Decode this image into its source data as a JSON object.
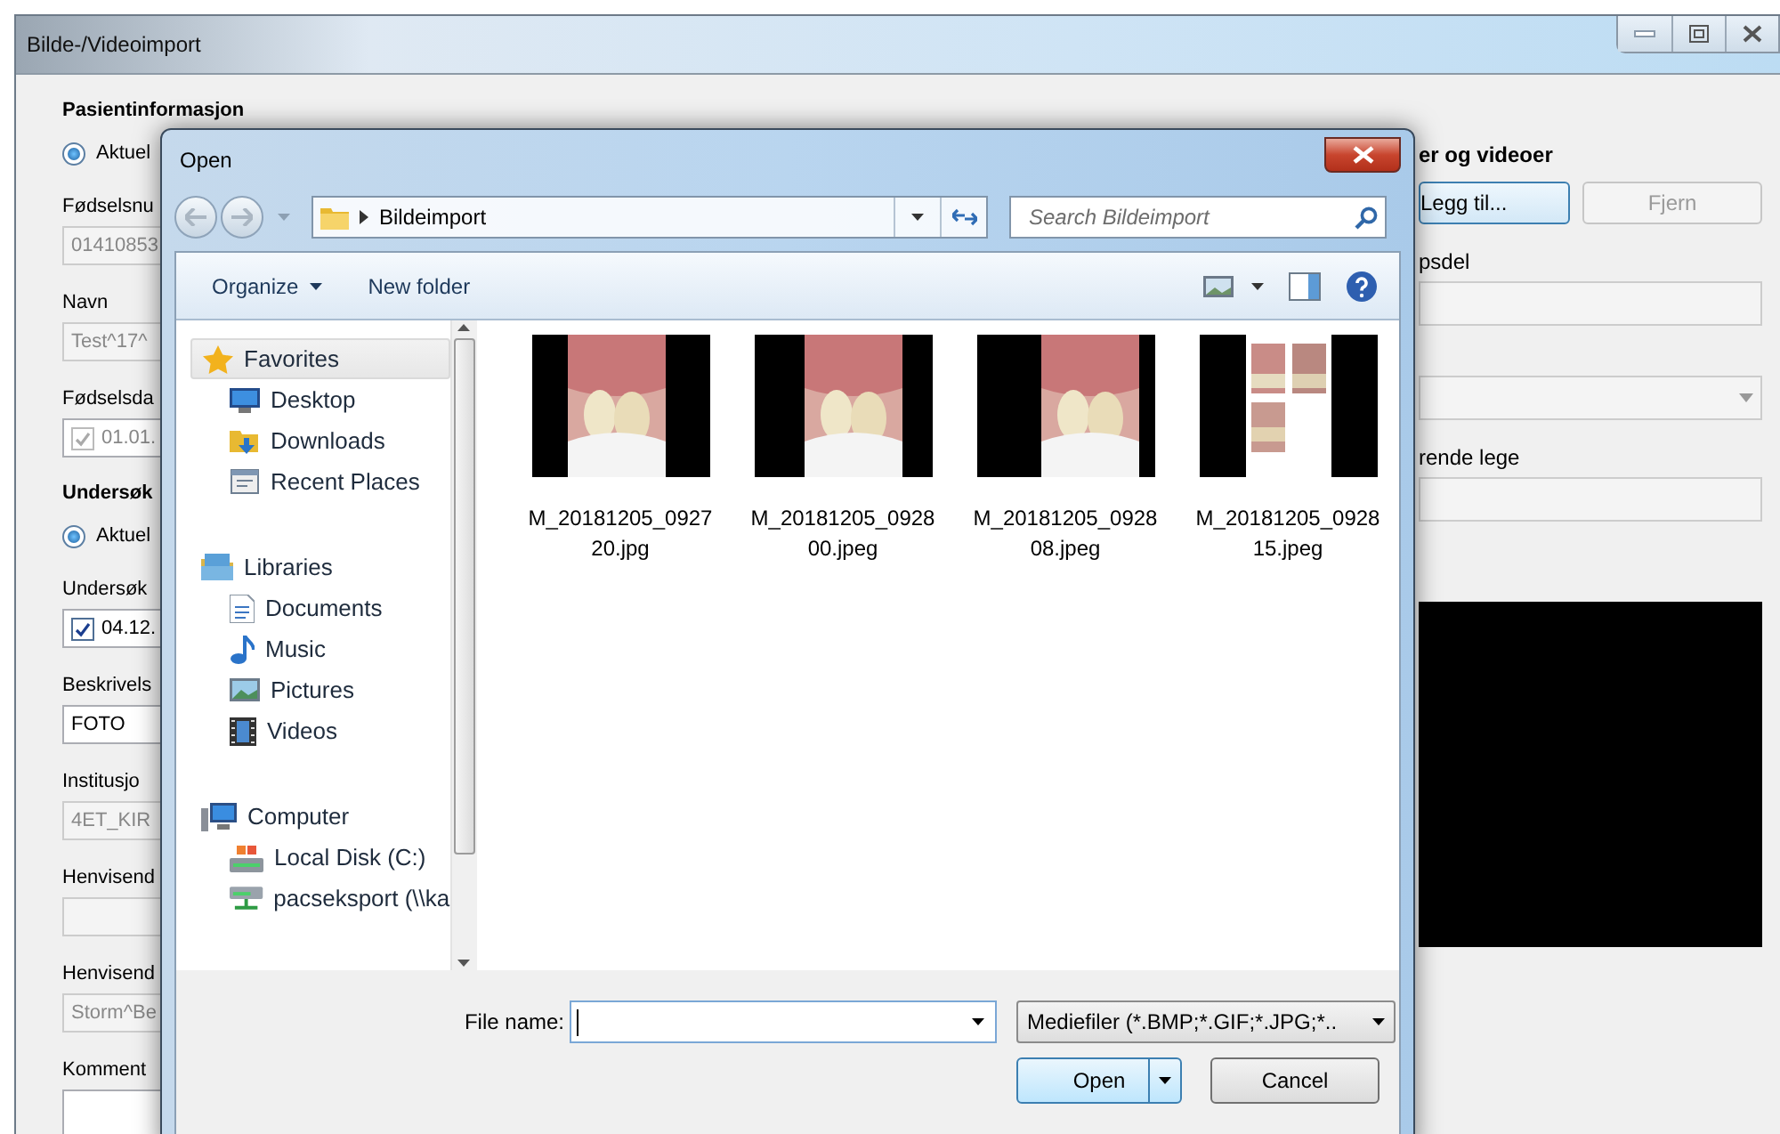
{
  "window": {
    "title": "Bilde-/Videoimport"
  },
  "left_panel": {
    "items": [
      {
        "kind": "heading",
        "text": "Pasientinformasjon"
      },
      {
        "kind": "radio",
        "label": "Aktuel",
        "selected": true
      },
      {
        "kind": "label",
        "text": "Fødselsnu"
      },
      {
        "kind": "field",
        "value": "01410853",
        "disabled": true
      },
      {
        "kind": "label",
        "text": "Navn"
      },
      {
        "kind": "field",
        "value": "Test^17^",
        "disabled": true
      },
      {
        "kind": "label",
        "text": "Fødselsda"
      },
      {
        "kind": "date",
        "value": "01.01.",
        "checked": true,
        "disabled": true
      },
      {
        "kind": "heading",
        "text": "Undersøk"
      },
      {
        "kind": "radio",
        "label": "Aktuel",
        "selected": true
      },
      {
        "kind": "label",
        "text": "Undersøk"
      },
      {
        "kind": "date",
        "value": "04.12.",
        "checked": true,
        "disabled": false
      },
      {
        "kind": "label",
        "text": "Beskrivels"
      },
      {
        "kind": "field",
        "value": "FOTO",
        "disabled": false
      },
      {
        "kind": "label",
        "text": "Institusjo"
      },
      {
        "kind": "field",
        "value": "4ET_KIR",
        "disabled": true
      },
      {
        "kind": "label",
        "text": "Henvisend"
      },
      {
        "kind": "field",
        "disabled": true
      },
      {
        "kind": "label",
        "text": "Henvisend"
      },
      {
        "kind": "field",
        "value": "Storm^Be",
        "disabled": true
      },
      {
        "kind": "label",
        "text": "Komment"
      },
      {
        "kind": "textarea",
        "disabled": false
      }
    ]
  },
  "right_panel": {
    "items": [
      {
        "kind": "heading",
        "text": "er og videoer"
      },
      {
        "kind": "buttons",
        "buttons": [
          {
            "label": "Legg til...",
            "disabled": false
          },
          {
            "label": "Fjern",
            "disabled": true
          }
        ]
      },
      {
        "kind": "label",
        "text": "psdel"
      },
      {
        "kind": "field",
        "disabled": true
      },
      {
        "kind": "dropdown",
        "disabled": true
      },
      {
        "kind": "label",
        "text": "rende lege"
      },
      {
        "kind": "field",
        "disabled": true
      },
      {
        "kind": "preview"
      }
    ]
  },
  "dialog": {
    "title": "Open",
    "address": "Bildeimport",
    "search": {
      "placeholder": "Search Bildeimport"
    },
    "toolbar": [
      {
        "label": "Organize",
        "menu": true
      },
      {
        "label": "New folder",
        "menu": false
      }
    ],
    "nav_tree": [
      {
        "label": "Favorites",
        "selected": true,
        "children": [
          {
            "label": "Desktop",
            "selected": false
          },
          {
            "label": "Downloads",
            "selected": false
          },
          {
            "label": "Recent Places",
            "selected": false
          }
        ]
      },
      {
        "label": "Libraries",
        "selected": false,
        "children": [
          {
            "label": "Documents",
            "selected": false
          },
          {
            "label": "Music",
            "selected": false
          },
          {
            "label": "Pictures",
            "selected": false
          },
          {
            "label": "Videos",
            "selected": false
          }
        ]
      },
      {
        "label": "Computer",
        "selected": false,
        "children": [
          {
            "label": "Local Disk (C:)",
            "selected": false
          },
          {
            "label": "pacseksport (\\\\ka",
            "selected": false
          }
        ]
      }
    ],
    "files": [
      {
        "name": "M_20181205_092720.jpg"
      },
      {
        "name": "M_20181205_092800.jpeg"
      },
      {
        "name": "M_20181205_092808.jpeg"
      },
      {
        "name": "M_20181205_092815.jpeg",
        "kind": "collage"
      }
    ],
    "file_name": {
      "label": "File name:"
    },
    "filter": "Mediefiler (*.BMP;*.GIF;*.JPG;*..",
    "buttons": [
      "Open",
      "Cancel"
    ]
  }
}
